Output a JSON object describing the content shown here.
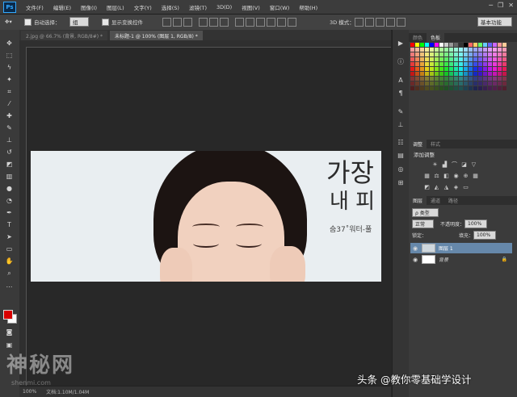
{
  "app": {
    "logo": "Ps"
  },
  "menu": [
    "文件(F)",
    "编辑(E)",
    "图像(I)",
    "图层(L)",
    "文字(Y)",
    "选择(S)",
    "滤镜(T)",
    "3D(D)",
    "视图(V)",
    "窗口(W)",
    "帮助(H)"
  ],
  "window_controls": {
    "minimize": "─",
    "restore": "❐",
    "close": "✕"
  },
  "options": {
    "auto_select_label": "自动选择：",
    "auto_select_value": "组",
    "transform_label": "显示变换控件",
    "mode_3d_label": "3D 模式：",
    "workspace": "基本功能"
  },
  "tabs": [
    {
      "label": "2.jpg @ 66.7% (背景, RGB/8#) *",
      "active": false
    },
    {
      "label": "未标题-1 @ 100% (图层 1, RGB/8) *",
      "active": true
    }
  ],
  "canvas": {
    "ad_line1": "가장",
    "ad_line2": "내 피",
    "ad_line3": "숨37˚워터-풀"
  },
  "panels": {
    "color_tabs": [
      "颜色",
      "色板"
    ],
    "adjust_tabs": [
      "调整",
      "样式"
    ],
    "adjust_title": "添加调整",
    "layers_tabs": [
      "图层",
      "通道",
      "路径"
    ],
    "kind_select": "ρ 类型",
    "blend_mode": "正常",
    "opacity_label": "不透明度：",
    "opacity_value": "100%",
    "lock_label": "锁定：",
    "fill_label": "填充：",
    "fill_value": "100%",
    "layers": [
      {
        "name": "图层 1",
        "selected": true
      },
      {
        "name": "背景",
        "selected": false
      }
    ]
  },
  "status": {
    "zoom": "100%",
    "doc": "文档:1.10M/1.04M"
  },
  "watermark": {
    "left": "神秘网",
    "left_sub": "shenmi.com",
    "right": "头条 @教你零基础学设计"
  }
}
